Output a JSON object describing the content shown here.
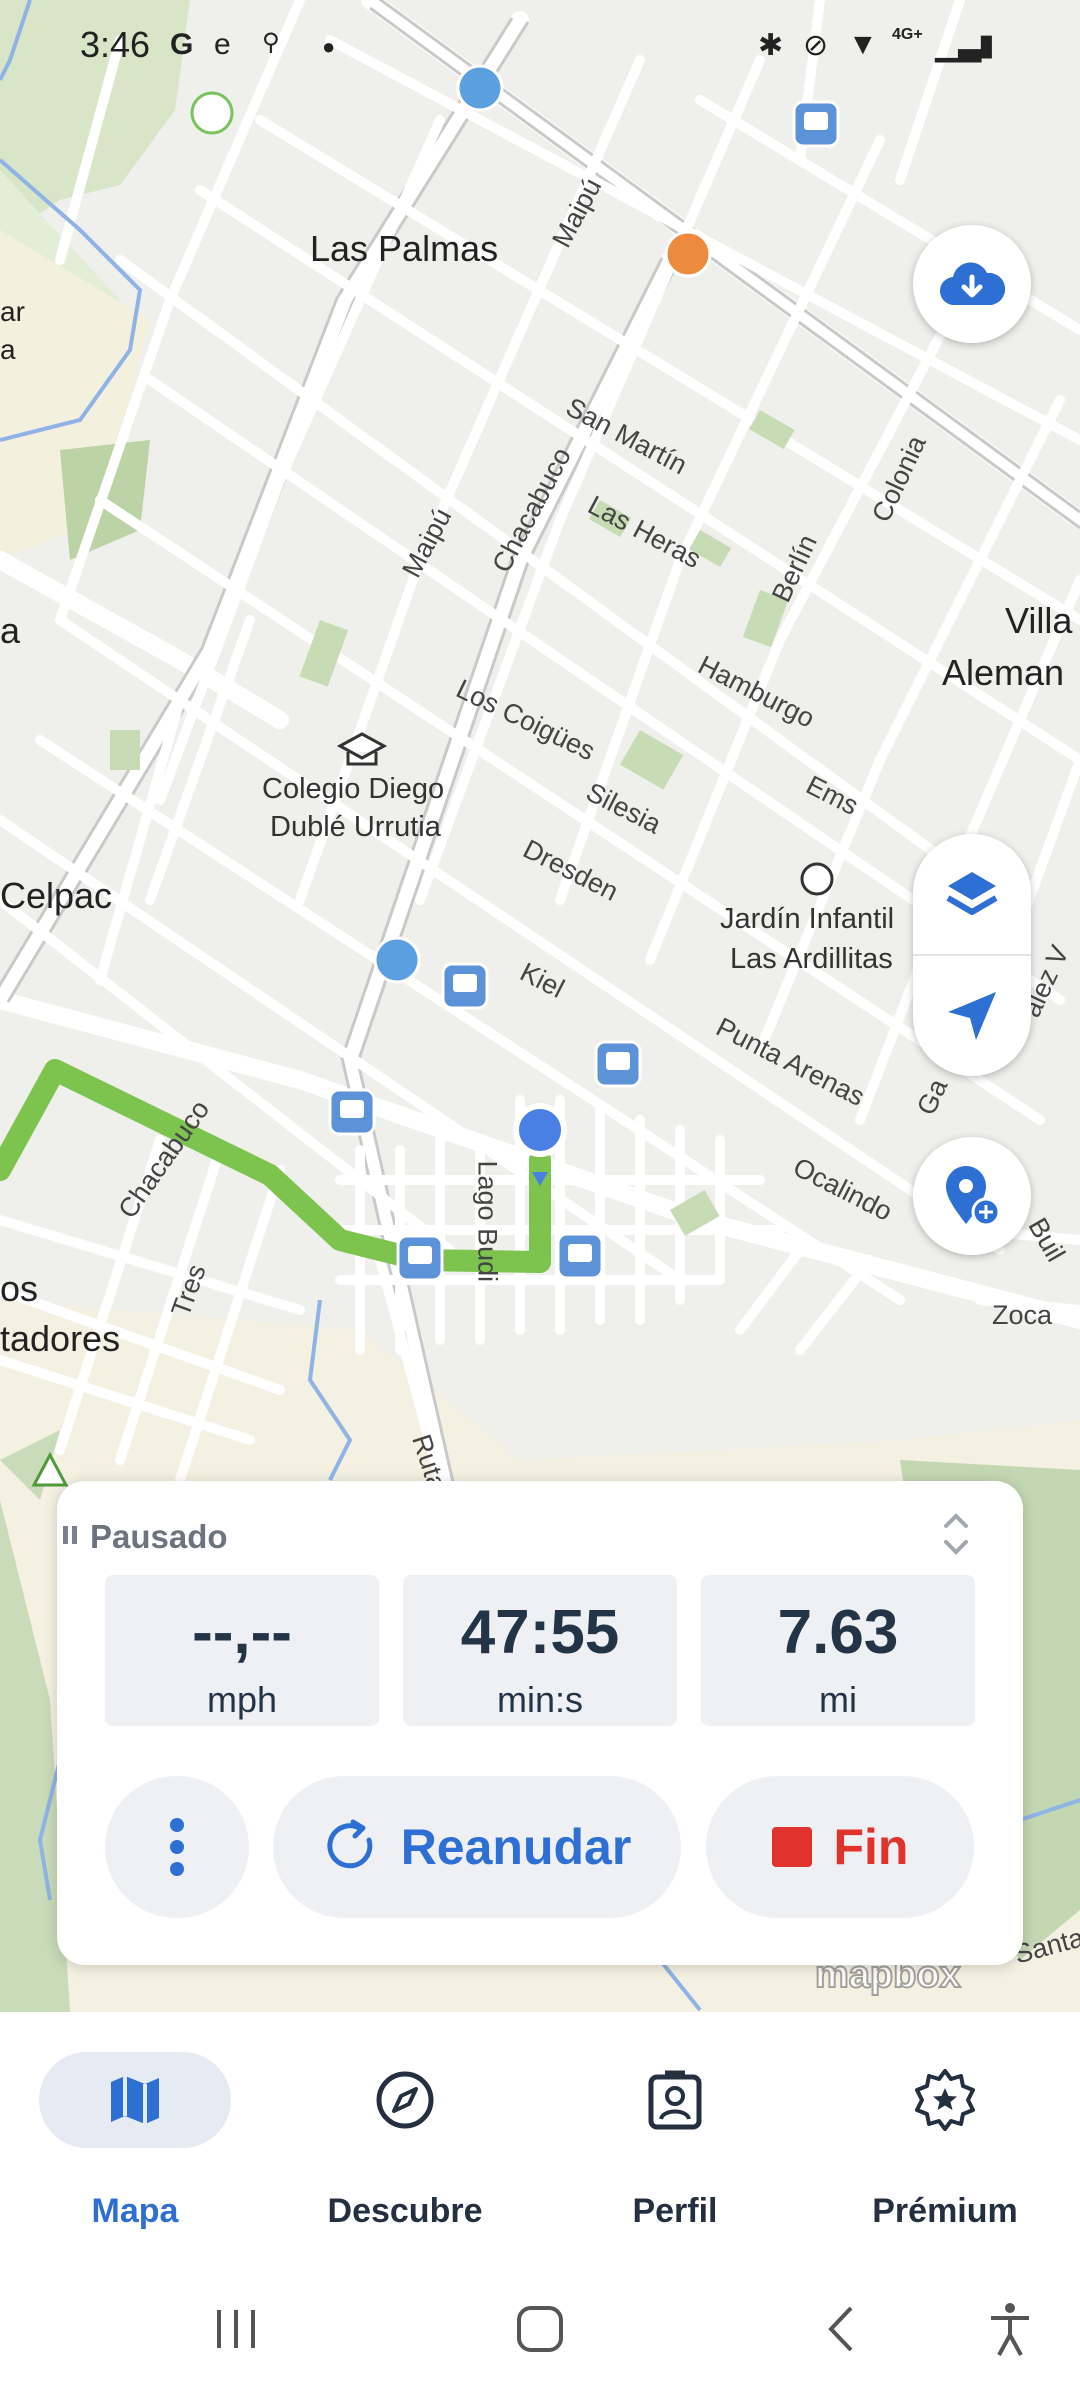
{
  "status_bar": {
    "time": "3:46",
    "left_icons": [
      "google-icon",
      "app-icon",
      "bike-icon",
      "dot-icon"
    ],
    "right_icons": [
      "bluetooth-icon",
      "mute-icon",
      "location-icon",
      "network-icon",
      "signal-icon",
      "battery-icon"
    ],
    "network_label": "4G+"
  },
  "map": {
    "place_labels": [
      "Las Palmas",
      "Villa",
      "Aleman",
      "Celpac",
      "ar",
      "a",
      "a",
      "os",
      "tadores"
    ],
    "street_labels": [
      "Maipú",
      "Maipú",
      "San Martín",
      "Chacabuco",
      "Las Heras",
      "Colonia",
      "Berlín",
      "Hamburgo",
      "Los Coigües",
      "Ems",
      "Silesia",
      "Dresden",
      "Kiel",
      "Punta Arenas",
      "Ocalindo",
      "Chacabuco",
      "Tres",
      "Lago Budi",
      "Ruta",
      "Zoca",
      "Ga",
      "Buil",
      "alez V",
      "Santa"
    ],
    "poi_labels": [
      "Colegio Diego",
      "Dublé Urrutia",
      "Jardín Infantil",
      "Las Ardillitas"
    ],
    "attribution": "mapbox",
    "route_color": "#7cc44e",
    "user_location_color": "#4a80e3"
  },
  "panel": {
    "status": "Pausado",
    "stats": [
      {
        "value": "--,--",
        "unit": "mph"
      },
      {
        "value": "47:55",
        "unit": "min:s"
      },
      {
        "value": "7.63",
        "unit": "mi"
      }
    ],
    "resume_label": "Reanudar",
    "end_label": "Fin"
  },
  "bottom_nav": {
    "items": [
      {
        "label": "Mapa",
        "icon": "map-icon",
        "active": true
      },
      {
        "label": "Descubre",
        "icon": "compass-icon",
        "active": false
      },
      {
        "label": "Perfil",
        "icon": "profile-icon",
        "active": false
      },
      {
        "label": "Prémium",
        "icon": "premium-star-icon",
        "active": false
      }
    ]
  },
  "colors": {
    "accent": "#2d6fd3",
    "danger": "#e0332b",
    "text_dark": "#243447"
  }
}
